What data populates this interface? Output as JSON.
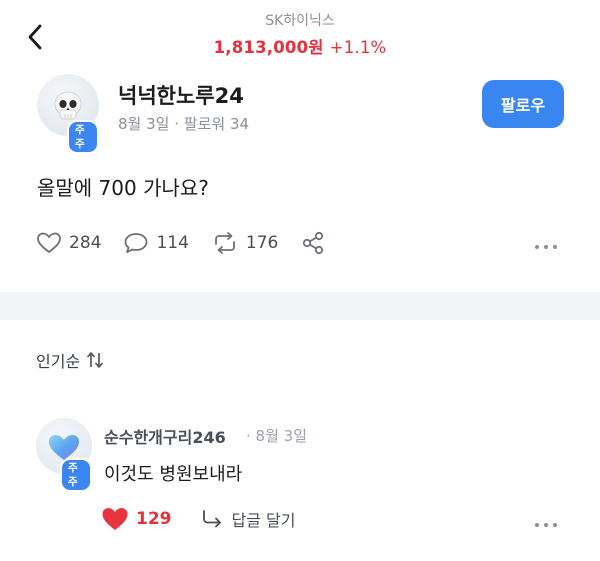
{
  "header": {
    "stock_name": "SK하이닉스",
    "price": "1,813,000원",
    "change": "+1.1%"
  },
  "post": {
    "author": "넉넉한노루24",
    "badge": "주주",
    "date": "8월 3일",
    "followers": "팔로워 34",
    "meta_sep": " · ",
    "follow_label": "팔로우",
    "body": "올말에 700 가나요?",
    "likes": "284",
    "comments": "114",
    "reposts": "176"
  },
  "sort": {
    "label": "인기순"
  },
  "comment": {
    "author": "순수한개구리246",
    "date": "· 8월 3일",
    "badge": "주주",
    "body": "이것도 병원보내라",
    "likes": "129",
    "reply_label": "답글 달기"
  },
  "colors": {
    "accent_blue": "#3a86f0",
    "price_red": "#e5303d",
    "muted": "#8a8f98"
  },
  "icons": [
    "back-arrow-icon",
    "skull-icon",
    "heart-outline-icon",
    "comment-bubble-icon",
    "repost-icon",
    "share-icon",
    "more-icon",
    "sort-arrows-icon",
    "blue-heart-icon",
    "heart-filled-icon",
    "reply-arrow-icon"
  ]
}
